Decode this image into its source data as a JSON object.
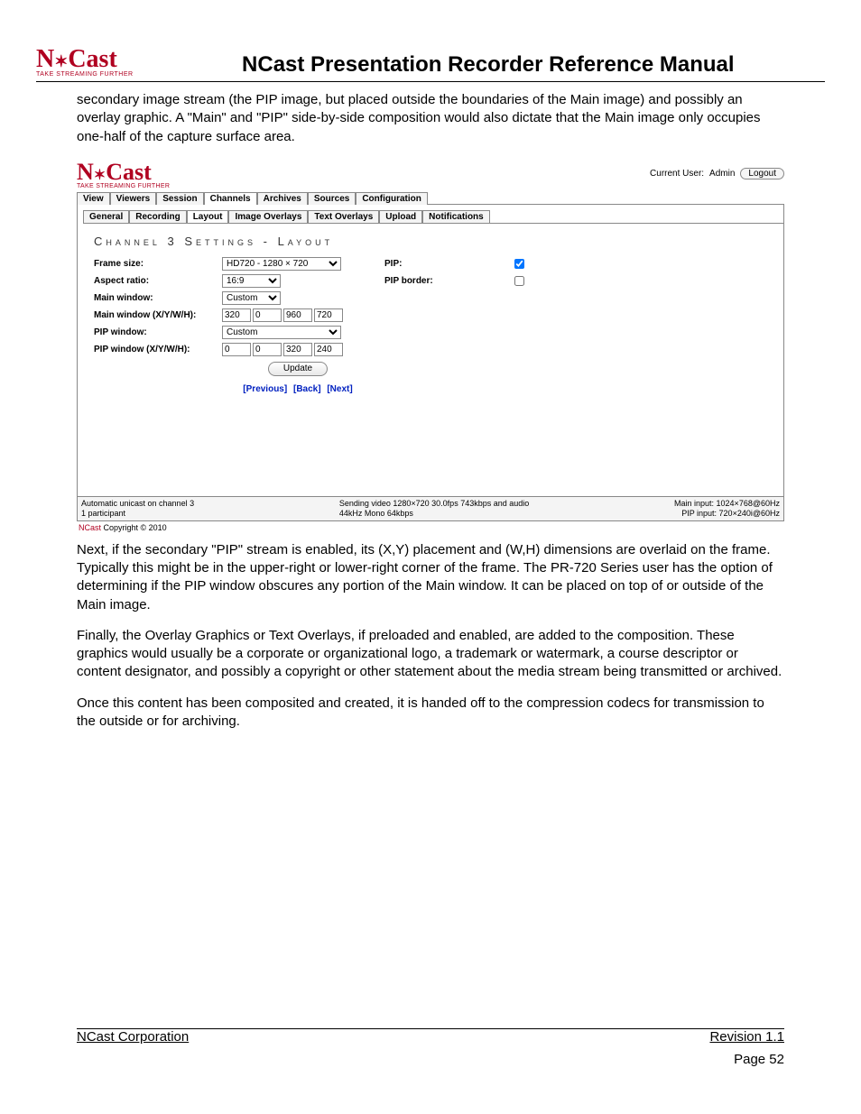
{
  "logo": {
    "text": "NCast",
    "sub": "TAKE STREAMING FURTHER"
  },
  "doc_title": "NCast Presentation Recorder Reference Manual",
  "para1": "secondary image stream (the PIP image, but placed outside the boundaries of the Main image) and possibly an overlay graphic. A \"Main\" and \"PIP\" side-by-side composition would also dictate that the Main image only occupies one-half of the capture surface area.",
  "ss": {
    "current_user_label": "Current User:",
    "current_user": "Admin",
    "logout": "Logout",
    "main_tabs": [
      "View",
      "Viewers",
      "Session",
      "Channels",
      "Archives",
      "Sources",
      "Configuration"
    ],
    "active_main_tab": 3,
    "sub_tabs": [
      "General",
      "Recording",
      "Layout",
      "Image Overlays",
      "Text Overlays",
      "Upload",
      "Notifications"
    ],
    "active_sub_tab": 2,
    "section_title": "Channel 3 Settings - Layout",
    "labels": {
      "frame_size": "Frame size:",
      "aspect_ratio": "Aspect ratio:",
      "main_window": "Main window:",
      "main_xywh": "Main window (X/Y/W/H):",
      "pip_window": "PIP window:",
      "pip_xywh": "PIP window (X/Y/W/H):",
      "pip": "PIP:",
      "pip_border": "PIP border:"
    },
    "values": {
      "frame_size": "HD720 - 1280 × 720",
      "aspect_ratio": "16:9",
      "main_window": "Custom",
      "main_xywh": [
        "320",
        "0",
        "960",
        "720"
      ],
      "pip_window": "Custom",
      "pip_xywh": [
        "0",
        "0",
        "320",
        "240"
      ],
      "pip_checked": true,
      "pip_border_checked": false
    },
    "update": "Update",
    "nav": {
      "prev": "[Previous]",
      "back": "[Back]",
      "next": "[Next]"
    },
    "status": {
      "left1": "Automatic unicast on channel 3",
      "left2": "1 participant",
      "mid1": "Sending video 1280×720 30.0fps 743kbps and audio",
      "mid2": "44kHz Mono 64kbps",
      "right1": "Main input: 1024×768@60Hz",
      "right2": "PIP input: 720×240i@60Hz"
    },
    "copyright": {
      "nc": "NCast",
      "rest": " Copyright © 2010"
    }
  },
  "para2": "Next, if the secondary \"PIP\" stream is enabled, its (X,Y) placement and (W,H) dimensions are overlaid on the frame. Typically this might be in the upper-right or lower-right corner of the frame. The PR-720 Series user has the option of determining if the PIP window obscures any portion of the Main window. It can be placed on top of or outside of the Main image.",
  "para3": "Finally, the Overlay Graphics or Text Overlays, if preloaded and enabled, are added to the composition. These graphics would usually be a corporate or organizational logo, a trademark or watermark, a course descriptor or content designator, and possibly a copyright or other statement about the media stream being transmitted or archived.",
  "para4": "Once this content has been composited and created, it is handed off to the compression codecs for transmission to the outside or for archiving.",
  "footer": {
    "left": "NCast Corporation",
    "right": "Revision 1.1"
  },
  "page_number": "Page 52"
}
